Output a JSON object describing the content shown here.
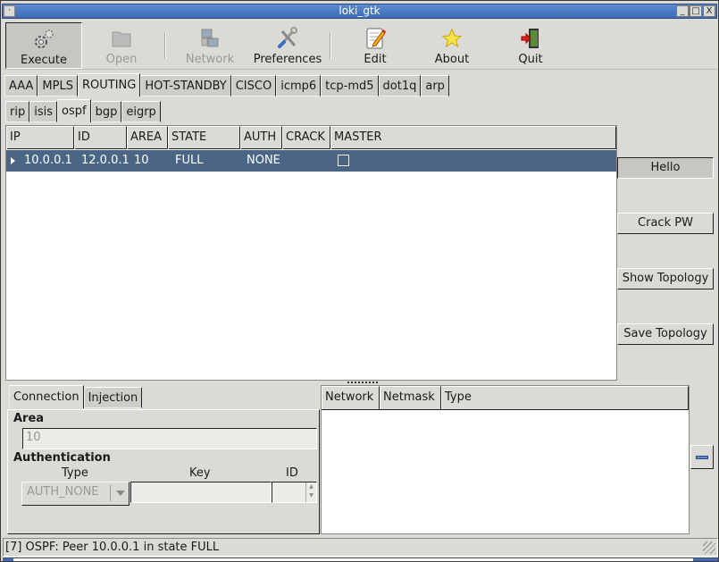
{
  "window": {
    "title": "loki_gtk",
    "menu_glyph": "·",
    "minimize_glyph": "_",
    "maximize_glyph": "□",
    "close_glyph": "X"
  },
  "toolbar": {
    "items": [
      {
        "label": "Execute",
        "icon": "gears-icon",
        "state": "active"
      },
      {
        "label": "Open",
        "icon": "folder-icon",
        "state": "disabled"
      },
      {
        "label": "Network",
        "icon": "network-icon",
        "state": "disabled"
      },
      {
        "label": "Preferences",
        "icon": "tools-icon",
        "state": "normal"
      },
      {
        "label": "Edit",
        "icon": "edit-icon",
        "state": "normal"
      },
      {
        "label": "About",
        "icon": "star-icon",
        "state": "normal"
      },
      {
        "label": "Quit",
        "icon": "exit-icon",
        "state": "normal"
      }
    ]
  },
  "protocol_tabs": {
    "items": [
      "AAA",
      "MPLS",
      "ROUTING",
      "HOT-STANDBY",
      "CISCO",
      "icmp6",
      "tcp-md5",
      "dot1q",
      "arp"
    ],
    "active": "ROUTING"
  },
  "routing_tabs": {
    "items": [
      "rip",
      "isis",
      "ospf",
      "bgp",
      "eigrp"
    ],
    "active": "ospf"
  },
  "peer_table": {
    "columns": [
      "IP",
      "ID",
      "AREA",
      "STATE",
      "AUTH",
      "CRACK",
      "MASTER"
    ],
    "rows": [
      {
        "ip": "10.0.0.1",
        "id": "12.0.0.1",
        "area": "10",
        "state": "FULL",
        "auth": "NONE",
        "crack": "",
        "master": false,
        "selected": true
      }
    ]
  },
  "side_buttons": {
    "hello": "Hello",
    "crack_pw": "Crack PW",
    "show_topology": "Show Topology",
    "save_topology": "Save Topology"
  },
  "detail_tabs": {
    "items": [
      "Connection",
      "Injection"
    ],
    "active": "Connection"
  },
  "connection": {
    "area_label": "Area",
    "area_value": "10",
    "auth_label": "Authentication",
    "type_label": "Type",
    "key_label": "Key",
    "id_label": "ID",
    "type_value": "AUTH_NONE",
    "key_value": "",
    "id_value": ""
  },
  "routes_table": {
    "columns": [
      "Network",
      "Netmask",
      "Type"
    ],
    "rows": []
  },
  "status": {
    "message": "[7] OSPF: Peer 10.0.0.1 in state FULL"
  }
}
